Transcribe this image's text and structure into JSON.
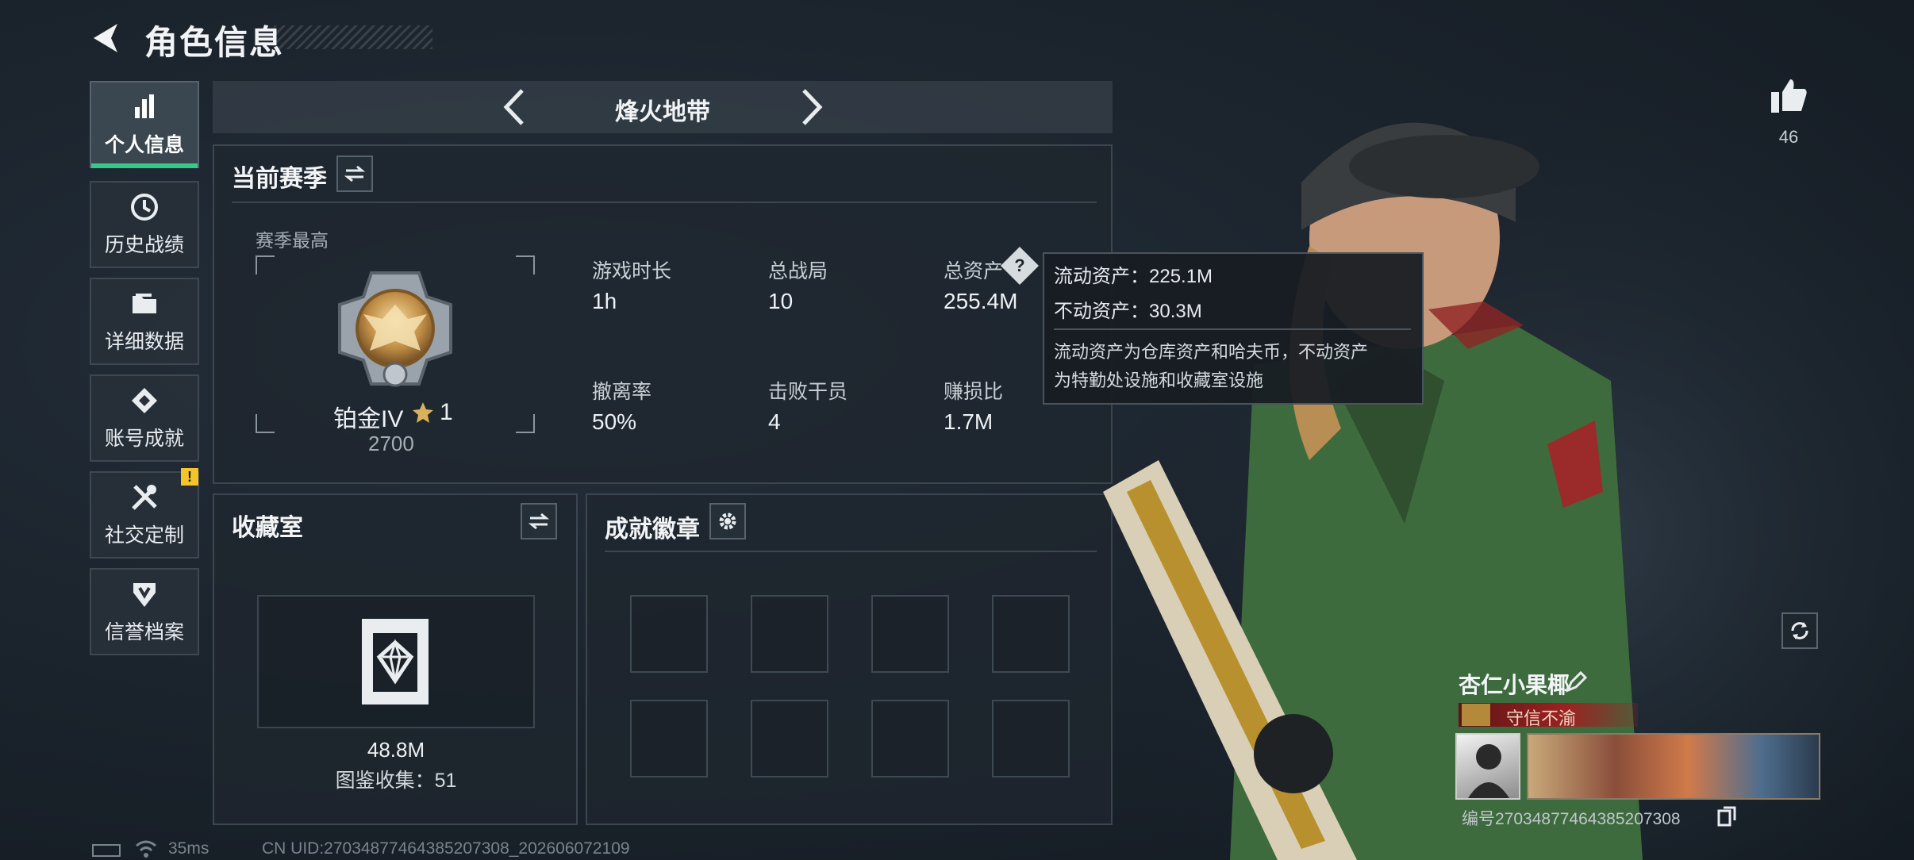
{
  "header": {
    "title": "角色信息"
  },
  "sidebar": {
    "items": [
      {
        "label": "个人信息",
        "icon": "bar-chart-icon",
        "active": true
      },
      {
        "label": "历史战绩",
        "icon": "history-icon"
      },
      {
        "label": "详细数据",
        "icon": "folder-icon"
      },
      {
        "label": "账号成就",
        "icon": "achievement-icon"
      },
      {
        "label": "社交定制",
        "icon": "tools-icon",
        "badge": "!"
      },
      {
        "label": "信誉档案",
        "icon": "credit-shield-icon"
      }
    ]
  },
  "mode_nav": {
    "label": "烽火地带"
  },
  "season": {
    "title": "当前赛季",
    "best_label": "赛季最高",
    "rank_name": "铂金IV",
    "rank_stars": "1",
    "rank_points": "2700",
    "stats": [
      {
        "label": "游戏时长",
        "value": "1h"
      },
      {
        "label": "总战局",
        "value": "10"
      },
      {
        "label": "总资产",
        "value": "255.4M"
      },
      {
        "label": "撤离率",
        "value": "50%"
      },
      {
        "label": "击败干员",
        "value": "4"
      },
      {
        "label": "赚损比",
        "value": "1.7M"
      }
    ]
  },
  "tooltip": {
    "line1": "流动资产：225.1M",
    "line2": "不动资产：30.3M",
    "desc1": "流动资产为仓库资产和哈夫币，不动资产",
    "desc2": "为特勤处设施和收藏室设施"
  },
  "collection": {
    "title": "收藏室",
    "value": "48.8M",
    "count_label": "图鉴收集：51"
  },
  "badges": {
    "title": "成就徽章"
  },
  "profile": {
    "likes": "46",
    "name": "杏仁小果椰",
    "reputation": "守信不渝",
    "id_label": "编号",
    "id_value": "2703487746438520730​8"
  },
  "status_bar": {
    "ping": "35ms",
    "uid": "CN UID:2703487746438520730​8_202606072109"
  },
  "colors": {
    "accent": "#36c98a",
    "warn": "#f3c52b",
    "reputation": "#8f1f1f"
  }
}
